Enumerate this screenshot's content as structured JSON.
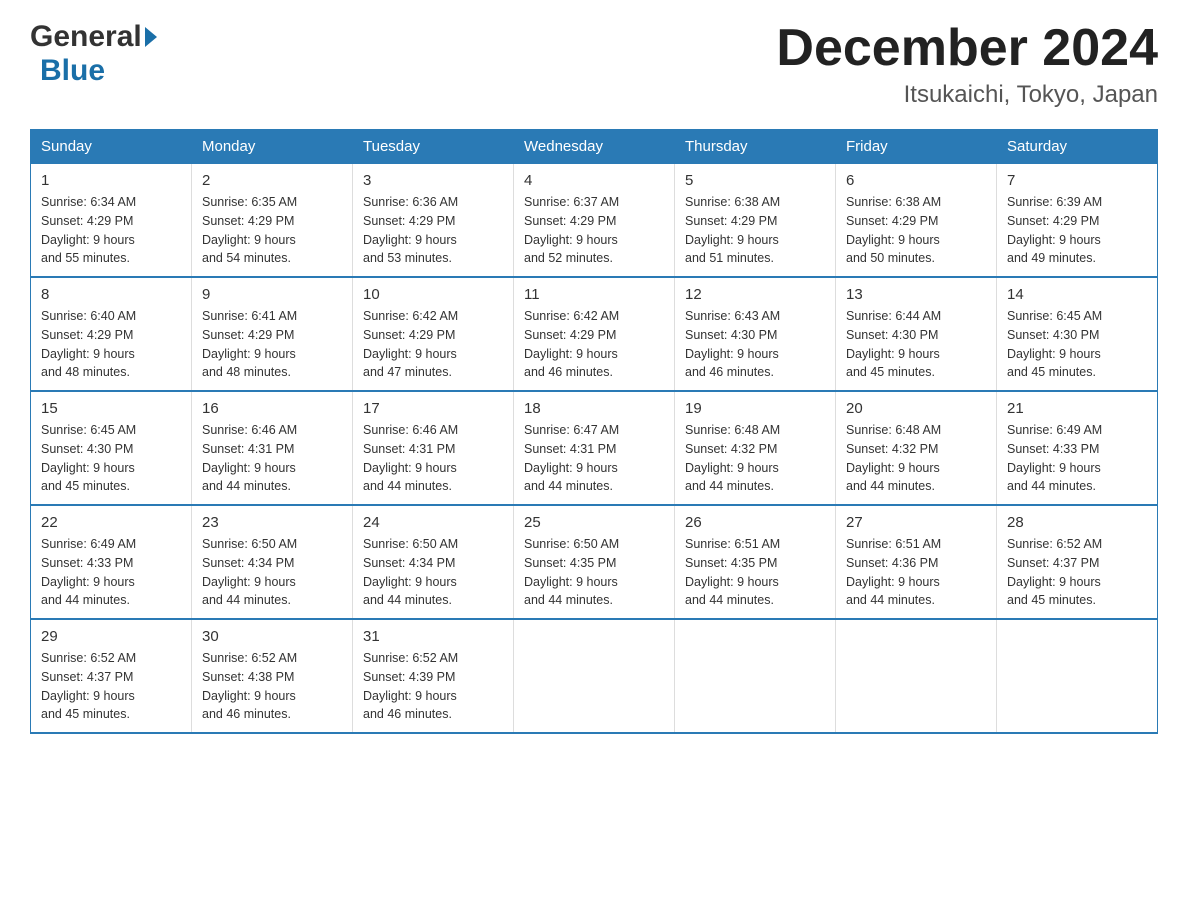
{
  "logo": {
    "general": "General",
    "blue": "Blue",
    "arrow": "▶"
  },
  "header": {
    "month_year": "December 2024",
    "location": "Itsukaichi, Tokyo, Japan"
  },
  "days_of_week": [
    "Sunday",
    "Monday",
    "Tuesday",
    "Wednesday",
    "Thursday",
    "Friday",
    "Saturday"
  ],
  "weeks": [
    [
      {
        "day": "1",
        "sunrise": "6:34 AM",
        "sunset": "4:29 PM",
        "daylight": "9 hours and 55 minutes."
      },
      {
        "day": "2",
        "sunrise": "6:35 AM",
        "sunset": "4:29 PM",
        "daylight": "9 hours and 54 minutes."
      },
      {
        "day": "3",
        "sunrise": "6:36 AM",
        "sunset": "4:29 PM",
        "daylight": "9 hours and 53 minutes."
      },
      {
        "day": "4",
        "sunrise": "6:37 AM",
        "sunset": "4:29 PM",
        "daylight": "9 hours and 52 minutes."
      },
      {
        "day": "5",
        "sunrise": "6:38 AM",
        "sunset": "4:29 PM",
        "daylight": "9 hours and 51 minutes."
      },
      {
        "day": "6",
        "sunrise": "6:38 AM",
        "sunset": "4:29 PM",
        "daylight": "9 hours and 50 minutes."
      },
      {
        "day": "7",
        "sunrise": "6:39 AM",
        "sunset": "4:29 PM",
        "daylight": "9 hours and 49 minutes."
      }
    ],
    [
      {
        "day": "8",
        "sunrise": "6:40 AM",
        "sunset": "4:29 PM",
        "daylight": "9 hours and 48 minutes."
      },
      {
        "day": "9",
        "sunrise": "6:41 AM",
        "sunset": "4:29 PM",
        "daylight": "9 hours and 48 minutes."
      },
      {
        "day": "10",
        "sunrise": "6:42 AM",
        "sunset": "4:29 PM",
        "daylight": "9 hours and 47 minutes."
      },
      {
        "day": "11",
        "sunrise": "6:42 AM",
        "sunset": "4:29 PM",
        "daylight": "9 hours and 46 minutes."
      },
      {
        "day": "12",
        "sunrise": "6:43 AM",
        "sunset": "4:30 PM",
        "daylight": "9 hours and 46 minutes."
      },
      {
        "day": "13",
        "sunrise": "6:44 AM",
        "sunset": "4:30 PM",
        "daylight": "9 hours and 45 minutes."
      },
      {
        "day": "14",
        "sunrise": "6:45 AM",
        "sunset": "4:30 PM",
        "daylight": "9 hours and 45 minutes."
      }
    ],
    [
      {
        "day": "15",
        "sunrise": "6:45 AM",
        "sunset": "4:30 PM",
        "daylight": "9 hours and 45 minutes."
      },
      {
        "day": "16",
        "sunrise": "6:46 AM",
        "sunset": "4:31 PM",
        "daylight": "9 hours and 44 minutes."
      },
      {
        "day": "17",
        "sunrise": "6:46 AM",
        "sunset": "4:31 PM",
        "daylight": "9 hours and 44 minutes."
      },
      {
        "day": "18",
        "sunrise": "6:47 AM",
        "sunset": "4:31 PM",
        "daylight": "9 hours and 44 minutes."
      },
      {
        "day": "19",
        "sunrise": "6:48 AM",
        "sunset": "4:32 PM",
        "daylight": "9 hours and 44 minutes."
      },
      {
        "day": "20",
        "sunrise": "6:48 AM",
        "sunset": "4:32 PM",
        "daylight": "9 hours and 44 minutes."
      },
      {
        "day": "21",
        "sunrise": "6:49 AM",
        "sunset": "4:33 PM",
        "daylight": "9 hours and 44 minutes."
      }
    ],
    [
      {
        "day": "22",
        "sunrise": "6:49 AM",
        "sunset": "4:33 PM",
        "daylight": "9 hours and 44 minutes."
      },
      {
        "day": "23",
        "sunrise": "6:50 AM",
        "sunset": "4:34 PM",
        "daylight": "9 hours and 44 minutes."
      },
      {
        "day": "24",
        "sunrise": "6:50 AM",
        "sunset": "4:34 PM",
        "daylight": "9 hours and 44 minutes."
      },
      {
        "day": "25",
        "sunrise": "6:50 AM",
        "sunset": "4:35 PM",
        "daylight": "9 hours and 44 minutes."
      },
      {
        "day": "26",
        "sunrise": "6:51 AM",
        "sunset": "4:35 PM",
        "daylight": "9 hours and 44 minutes."
      },
      {
        "day": "27",
        "sunrise": "6:51 AM",
        "sunset": "4:36 PM",
        "daylight": "9 hours and 44 minutes."
      },
      {
        "day": "28",
        "sunrise": "6:52 AM",
        "sunset": "4:37 PM",
        "daylight": "9 hours and 45 minutes."
      }
    ],
    [
      {
        "day": "29",
        "sunrise": "6:52 AM",
        "sunset": "4:37 PM",
        "daylight": "9 hours and 45 minutes."
      },
      {
        "day": "30",
        "sunrise": "6:52 AM",
        "sunset": "4:38 PM",
        "daylight": "9 hours and 46 minutes."
      },
      {
        "day": "31",
        "sunrise": "6:52 AM",
        "sunset": "4:39 PM",
        "daylight": "9 hours and 46 minutes."
      },
      null,
      null,
      null,
      null
    ]
  ],
  "labels": {
    "sunrise": "Sunrise:",
    "sunset": "Sunset:",
    "daylight": "Daylight:"
  }
}
